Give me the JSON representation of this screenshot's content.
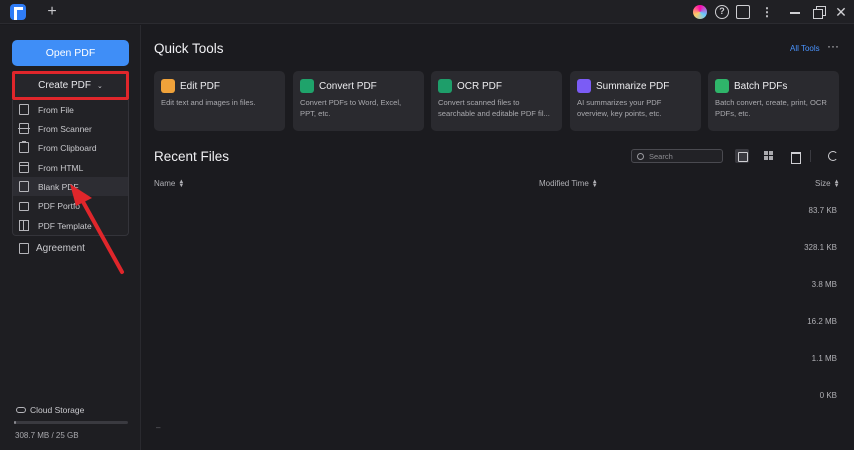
{
  "titlebar": {
    "new_tab": "+",
    "help_glyph": "?",
    "more_glyph": "⋮",
    "close_glyph": "✕"
  },
  "sidebar": {
    "open_pdf": "Open PDF",
    "create_pdf": "Create PDF",
    "create_menu": [
      {
        "label": "From File",
        "icon": "file-icon"
      },
      {
        "label": "From Scanner",
        "icon": "scanner-icon"
      },
      {
        "label": "From Clipboard",
        "icon": "clipboard-icon"
      },
      {
        "label": "From HTML",
        "icon": "html-icon"
      },
      {
        "label": "Blank PDF",
        "icon": "blank-page-icon"
      },
      {
        "label": "PDF Portfo",
        "icon": "folder-icon"
      },
      {
        "label": "PDF Template",
        "icon": "template-icon"
      }
    ],
    "agreement": "Agreement",
    "cloud_storage": "Cloud Storage",
    "storage_used": "308.7 MB / 25 GB",
    "storage_fraction": 0.012
  },
  "quick_tools": {
    "title": "Quick Tools",
    "all_tools": "All Tools",
    "cards": [
      {
        "title": "Edit PDF",
        "desc": "Edit text and images in files.",
        "color": "#f0a23a"
      },
      {
        "title": "Convert PDF",
        "desc": "Convert PDFs to Word, Excel, PPT, etc.",
        "color": "#1fa36b"
      },
      {
        "title": "OCR PDF",
        "desc": "Convert scanned files to searchable and editable PDF fil...",
        "color": "#1e9e6a"
      },
      {
        "title": "Summarize PDF",
        "desc": "AI summarizes your PDF overview, key points, etc.",
        "color": "#7b5cf5"
      },
      {
        "title": "Batch PDFs",
        "desc": "Batch convert, create, print, OCR PDFs, etc.",
        "color": "#2fb56a"
      }
    ]
  },
  "recent": {
    "title": "Recent Files",
    "search_placeholder": "Search",
    "columns": {
      "name": "Name",
      "modified": "Modified Time",
      "size": "Size"
    },
    "sizes": [
      "83.7 KB",
      "328.1 KB",
      "3.8 MB",
      "16.2 MB",
      "1.1 MB",
      "0 KB"
    ],
    "trailing": "–"
  },
  "colors": {
    "accent": "#3f8ef7",
    "highlight_red": "#e0262b"
  }
}
